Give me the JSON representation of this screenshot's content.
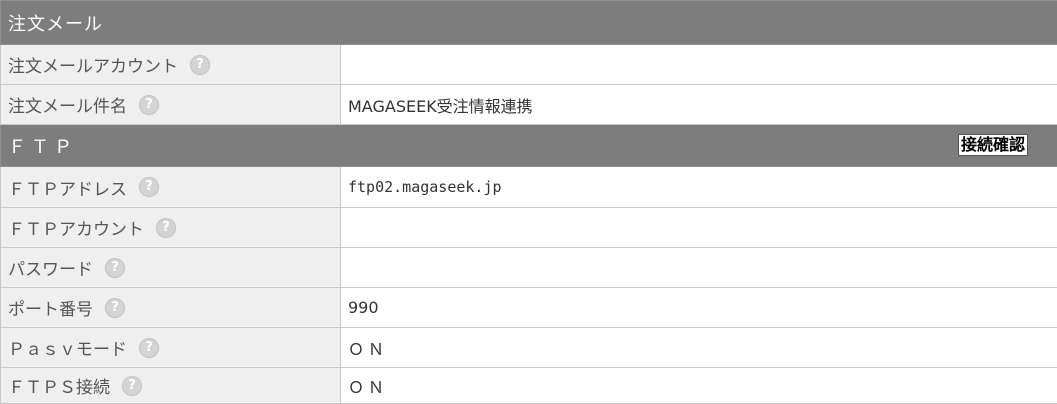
{
  "sections": {
    "order_mail": {
      "title": "注文メール",
      "rows": [
        {
          "label": "注文メールアカウント",
          "value": ""
        },
        {
          "label": "注文メール件名",
          "value": "MAGASEEK受注情報連携"
        }
      ]
    },
    "ftp": {
      "title": "ＦＴＰ",
      "connect_button": "接続確認",
      "rows": [
        {
          "label": "ＦＴＰアドレス",
          "value": "ftp02.magaseek.jp"
        },
        {
          "label": "ＦＴＰアカウント",
          "value": ""
        },
        {
          "label": "パスワード",
          "value": ""
        },
        {
          "label": "ポート番号",
          "value": "990"
        },
        {
          "label": "Ｐａｓｖモード",
          "value": "ＯＮ"
        },
        {
          "label": "ＦＴＰＳ接続",
          "value": "ＯＮ"
        }
      ]
    }
  },
  "help_icon": "?",
  "icons": {
    "help": "question-circle-icon"
  },
  "colors": {
    "header_bg": "#7d7d7d",
    "label_bg": "#efefef",
    "border": "#c8c8c8"
  }
}
